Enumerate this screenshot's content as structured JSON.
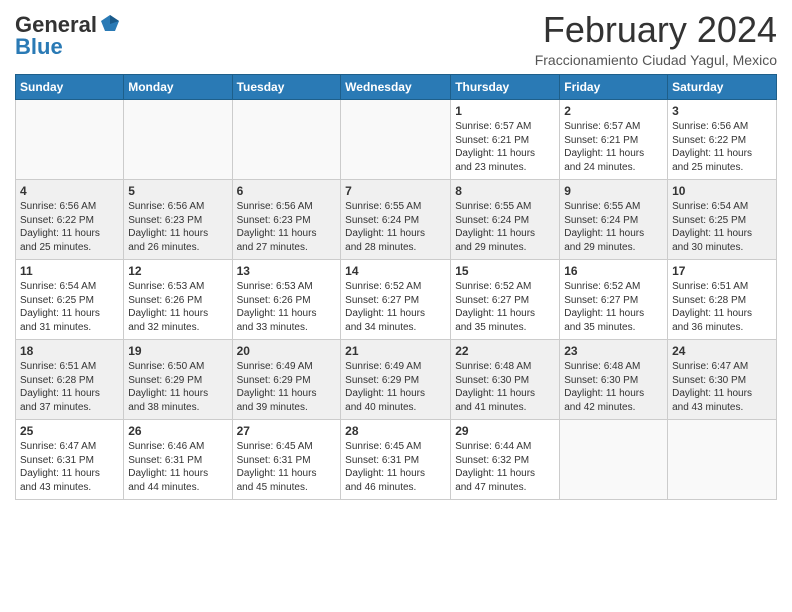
{
  "logo": {
    "general": "General",
    "blue": "Blue",
    "icon_title": "GeneralBlue Logo"
  },
  "title": "February 2024",
  "subtitle": "Fraccionamiento Ciudad Yagul, Mexico",
  "headers": [
    "Sunday",
    "Monday",
    "Tuesday",
    "Wednesday",
    "Thursday",
    "Friday",
    "Saturday"
  ],
  "weeks": [
    [
      {
        "num": "",
        "info": ""
      },
      {
        "num": "",
        "info": ""
      },
      {
        "num": "",
        "info": ""
      },
      {
        "num": "",
        "info": ""
      },
      {
        "num": "1",
        "info": "Sunrise: 6:57 AM\nSunset: 6:21 PM\nDaylight: 11 hours\nand 23 minutes."
      },
      {
        "num": "2",
        "info": "Sunrise: 6:57 AM\nSunset: 6:21 PM\nDaylight: 11 hours\nand 24 minutes."
      },
      {
        "num": "3",
        "info": "Sunrise: 6:56 AM\nSunset: 6:22 PM\nDaylight: 11 hours\nand 25 minutes."
      }
    ],
    [
      {
        "num": "4",
        "info": "Sunrise: 6:56 AM\nSunset: 6:22 PM\nDaylight: 11 hours\nand 25 minutes."
      },
      {
        "num": "5",
        "info": "Sunrise: 6:56 AM\nSunset: 6:23 PM\nDaylight: 11 hours\nand 26 minutes."
      },
      {
        "num": "6",
        "info": "Sunrise: 6:56 AM\nSunset: 6:23 PM\nDaylight: 11 hours\nand 27 minutes."
      },
      {
        "num": "7",
        "info": "Sunrise: 6:55 AM\nSunset: 6:24 PM\nDaylight: 11 hours\nand 28 minutes."
      },
      {
        "num": "8",
        "info": "Sunrise: 6:55 AM\nSunset: 6:24 PM\nDaylight: 11 hours\nand 29 minutes."
      },
      {
        "num": "9",
        "info": "Sunrise: 6:55 AM\nSunset: 6:24 PM\nDaylight: 11 hours\nand 29 minutes."
      },
      {
        "num": "10",
        "info": "Sunrise: 6:54 AM\nSunset: 6:25 PM\nDaylight: 11 hours\nand 30 minutes."
      }
    ],
    [
      {
        "num": "11",
        "info": "Sunrise: 6:54 AM\nSunset: 6:25 PM\nDaylight: 11 hours\nand 31 minutes."
      },
      {
        "num": "12",
        "info": "Sunrise: 6:53 AM\nSunset: 6:26 PM\nDaylight: 11 hours\nand 32 minutes."
      },
      {
        "num": "13",
        "info": "Sunrise: 6:53 AM\nSunset: 6:26 PM\nDaylight: 11 hours\nand 33 minutes."
      },
      {
        "num": "14",
        "info": "Sunrise: 6:52 AM\nSunset: 6:27 PM\nDaylight: 11 hours\nand 34 minutes."
      },
      {
        "num": "15",
        "info": "Sunrise: 6:52 AM\nSunset: 6:27 PM\nDaylight: 11 hours\nand 35 minutes."
      },
      {
        "num": "16",
        "info": "Sunrise: 6:52 AM\nSunset: 6:27 PM\nDaylight: 11 hours\nand 35 minutes."
      },
      {
        "num": "17",
        "info": "Sunrise: 6:51 AM\nSunset: 6:28 PM\nDaylight: 11 hours\nand 36 minutes."
      }
    ],
    [
      {
        "num": "18",
        "info": "Sunrise: 6:51 AM\nSunset: 6:28 PM\nDaylight: 11 hours\nand 37 minutes."
      },
      {
        "num": "19",
        "info": "Sunrise: 6:50 AM\nSunset: 6:29 PM\nDaylight: 11 hours\nand 38 minutes."
      },
      {
        "num": "20",
        "info": "Sunrise: 6:49 AM\nSunset: 6:29 PM\nDaylight: 11 hours\nand 39 minutes."
      },
      {
        "num": "21",
        "info": "Sunrise: 6:49 AM\nSunset: 6:29 PM\nDaylight: 11 hours\nand 40 minutes."
      },
      {
        "num": "22",
        "info": "Sunrise: 6:48 AM\nSunset: 6:30 PM\nDaylight: 11 hours\nand 41 minutes."
      },
      {
        "num": "23",
        "info": "Sunrise: 6:48 AM\nSunset: 6:30 PM\nDaylight: 11 hours\nand 42 minutes."
      },
      {
        "num": "24",
        "info": "Sunrise: 6:47 AM\nSunset: 6:30 PM\nDaylight: 11 hours\nand 43 minutes."
      }
    ],
    [
      {
        "num": "25",
        "info": "Sunrise: 6:47 AM\nSunset: 6:31 PM\nDaylight: 11 hours\nand 43 minutes."
      },
      {
        "num": "26",
        "info": "Sunrise: 6:46 AM\nSunset: 6:31 PM\nDaylight: 11 hours\nand 44 minutes."
      },
      {
        "num": "27",
        "info": "Sunrise: 6:45 AM\nSunset: 6:31 PM\nDaylight: 11 hours\nand 45 minutes."
      },
      {
        "num": "28",
        "info": "Sunrise: 6:45 AM\nSunset: 6:31 PM\nDaylight: 11 hours\nand 46 minutes."
      },
      {
        "num": "29",
        "info": "Sunrise: 6:44 AM\nSunset: 6:32 PM\nDaylight: 11 hours\nand 47 minutes."
      },
      {
        "num": "",
        "info": ""
      },
      {
        "num": "",
        "info": ""
      }
    ]
  ],
  "row_shades": [
    "white",
    "shade",
    "white",
    "shade",
    "white"
  ]
}
